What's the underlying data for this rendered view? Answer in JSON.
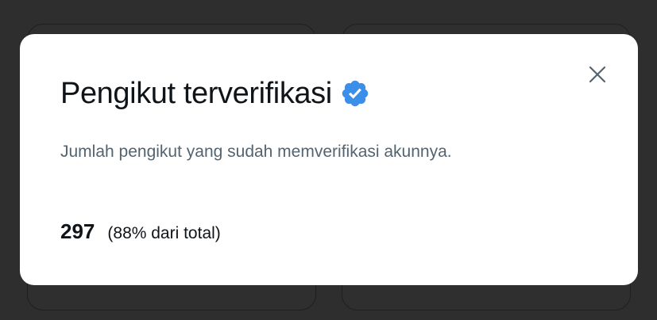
{
  "modal": {
    "title": "Pengikut terverifikasi",
    "subtitle": "Jumlah pengikut yang sudah memverifikasi akunnya.",
    "count": "297",
    "percent_text": "(88% dari total)",
    "badge_icon": "verified-badge-icon",
    "close_icon": "close-icon"
  },
  "colors": {
    "badge_blue": "#3b8fe8",
    "title_text": "#0f1419",
    "secondary_text": "#536471",
    "backdrop": "#2e2e2e",
    "close_icon": "#536471"
  }
}
